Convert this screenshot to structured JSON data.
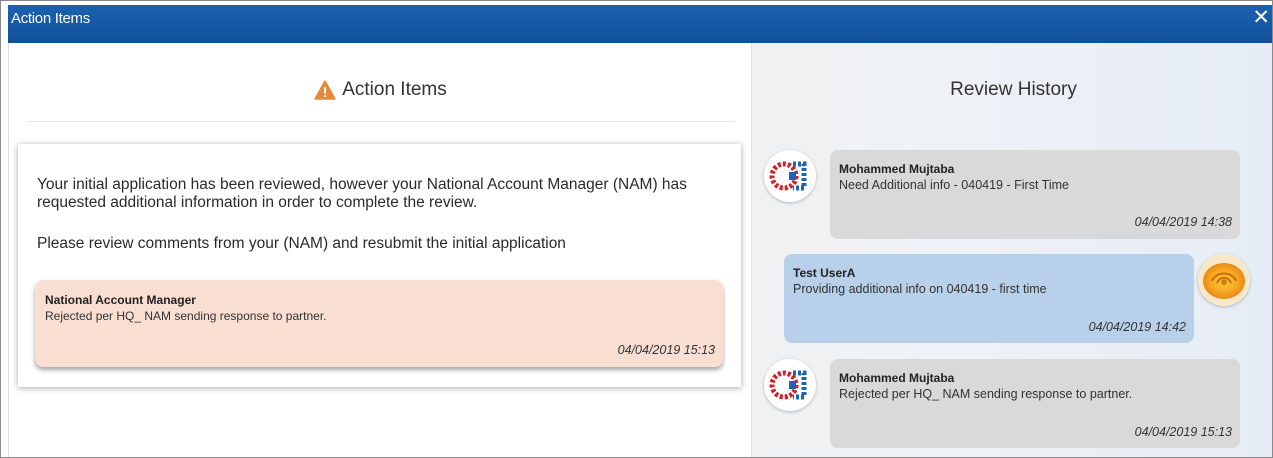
{
  "window": {
    "title": "Action Items",
    "close_glyph": "✕"
  },
  "action_panel": {
    "heading": "Action Items",
    "heading_icon": "warning-icon",
    "message_1": "Your initial application has been reviewed, however your National Account Manager (NAM) has requested additional information in order to complete the review.",
    "message_2": "Please review comments from your (NAM) and resubmit the initial application",
    "note": {
      "author": "National Account Manager",
      "text": "Rejected per HQ_ NAM sending response to partner.",
      "timestamp": "04/04/2019 15:13"
    }
  },
  "history_panel": {
    "heading": "Review History",
    "entries": [
      {
        "author": "Mohammed Mujtaba",
        "text": "Need Additional info - 040419 - First Time",
        "timestamp": "04/04/2019 14:38",
        "side": "left",
        "avatar": "company-logo-avatar"
      },
      {
        "author": "Test UserA",
        "text": "Providing additional info on 040419 - first time",
        "timestamp": "04/04/2019 14:42",
        "side": "right",
        "avatar": "rose-avatar"
      },
      {
        "author": "Mohammed Mujtaba",
        "text": "Rejected per HQ_ NAM sending response to partner.",
        "timestamp": "04/04/2019 15:13",
        "side": "left",
        "avatar": "company-logo-avatar"
      }
    ]
  },
  "colors": {
    "titlebar": "#1b62b0",
    "warning": "#e8883a",
    "note_bg": "#f9ded2",
    "bubble_gray": "#d9d9d9",
    "bubble_blue": "#b8d0ea"
  }
}
